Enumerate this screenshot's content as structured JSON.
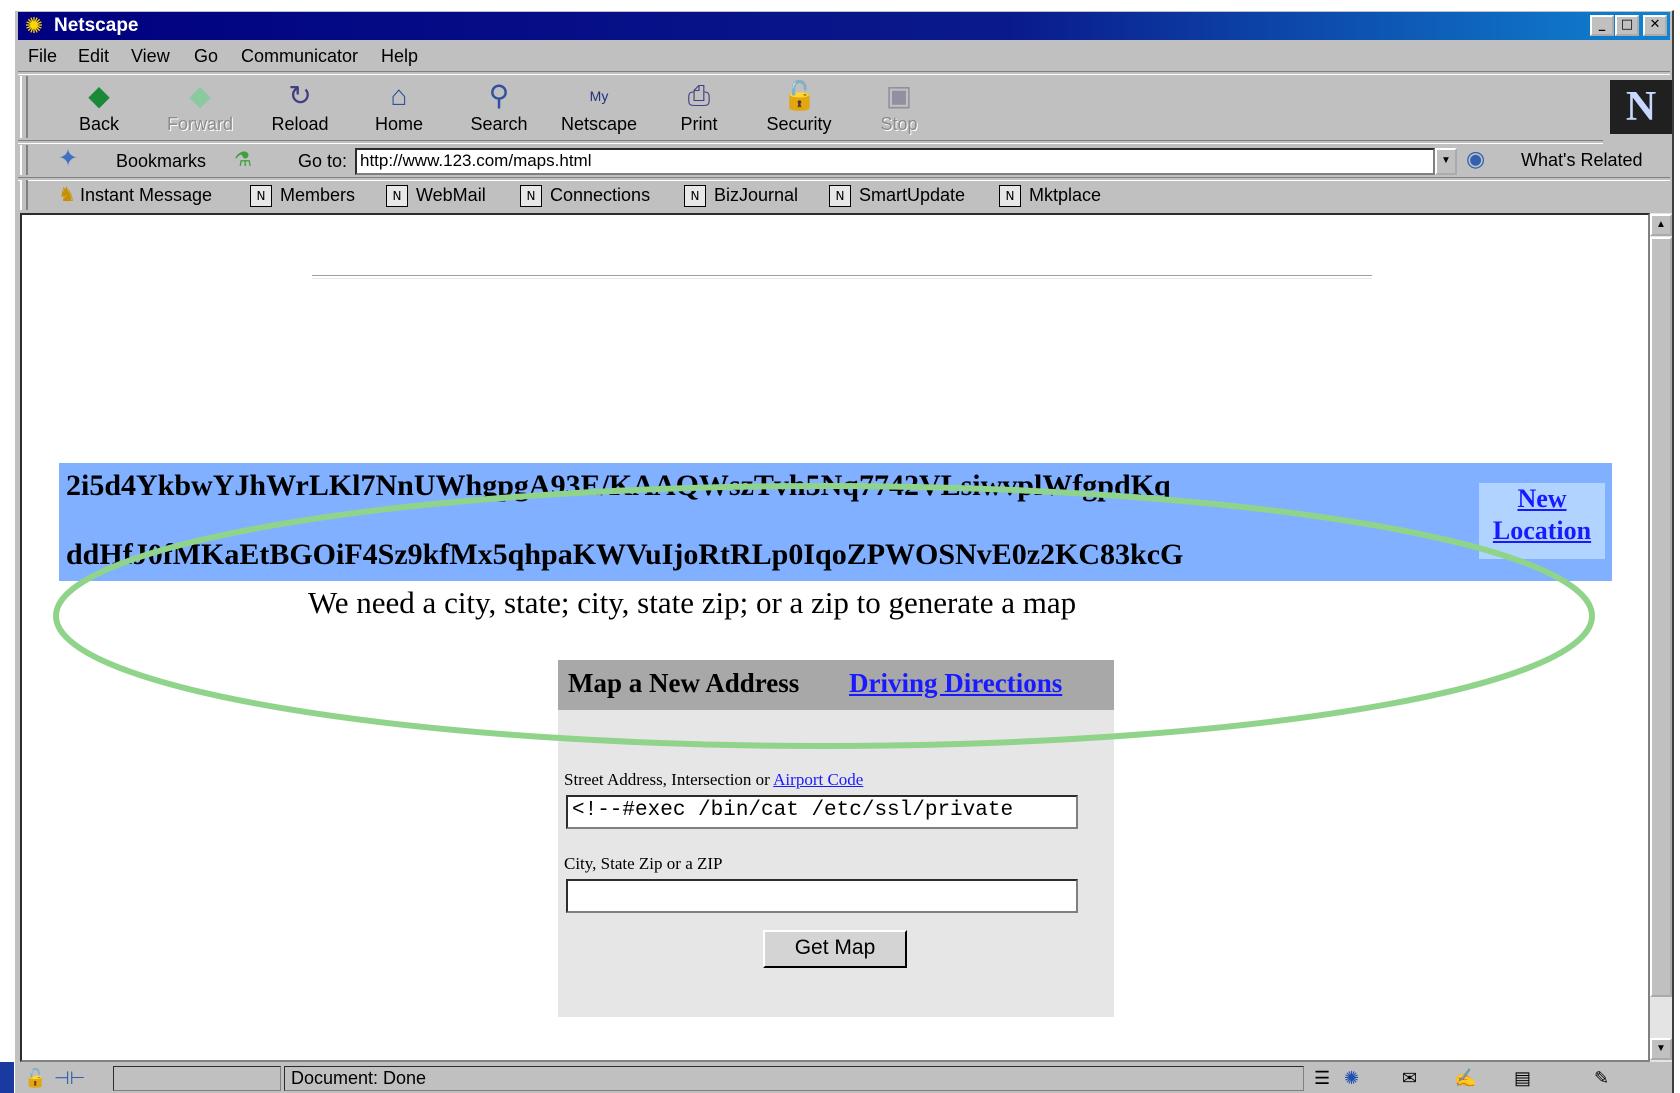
{
  "window": {
    "title": "Netscape",
    "controls": {
      "minimize": "_",
      "maximize": "□",
      "close": "✕"
    }
  },
  "menubar": [
    "File",
    "Edit",
    "View",
    "Go",
    "Communicator",
    "Help"
  ],
  "navigation_toolbar": [
    {
      "label": "Back",
      "icon": "back-arrow-icon",
      "enabled": true
    },
    {
      "label": "Forward",
      "icon": "forward-arrow-icon",
      "enabled": false
    },
    {
      "label": "Reload",
      "icon": "reload-icon",
      "enabled": true
    },
    {
      "label": "Home",
      "icon": "home-icon",
      "enabled": true
    },
    {
      "label": "Search",
      "icon": "search-icon",
      "enabled": true
    },
    {
      "label": "Netscape",
      "icon": "my-netscape-icon",
      "enabled": true
    },
    {
      "label": "Print",
      "icon": "print-icon",
      "enabled": true
    },
    {
      "label": "Security",
      "icon": "lock-icon",
      "enabled": true
    },
    {
      "label": "Stop",
      "icon": "stop-icon",
      "enabled": false
    }
  ],
  "location_bar": {
    "bookmarks_label": "Bookmarks",
    "goto_label": "Go to:",
    "url": "http://www.123.com/maps.html",
    "whats_related": "What's Related"
  },
  "personal_toolbar": [
    "Instant Message",
    "Members",
    "WebMail",
    "Connections",
    "BizJournal",
    "SmartUpdate",
    "Mktplace"
  ],
  "page": {
    "garbage_line_1": "2i5d4YkbwYJhWrLKl7NnUWhgpgA93E/KAAQWszTvh5Nq7742VLsiwvplWfgpdKq",
    "garbage_line_2": "ddHfJ0fMKaEtBGOiF4Sz9kfMx5qhpaKWVuIjoRtRLp0IqoZPWOSNvE0z2KC83kcG",
    "new_location": "New Location",
    "error_message": "We need a city, state; city, state zip; or a zip to generate a map",
    "form": {
      "title": "Map a New Address",
      "driving_directions": "Driving Directions",
      "street_label": "Street Address, Intersection or",
      "airport_code": "Airport Code",
      "street_value": "<!--#exec /bin/cat /etc/ssl/private",
      "city_label": "City, State Zip or a ZIP",
      "city_value": "",
      "submit": "Get Map"
    },
    "annotation_color": "#8fd48a",
    "banner_color": "#80b0ff"
  },
  "status_bar": {
    "text": "Document: Done"
  }
}
